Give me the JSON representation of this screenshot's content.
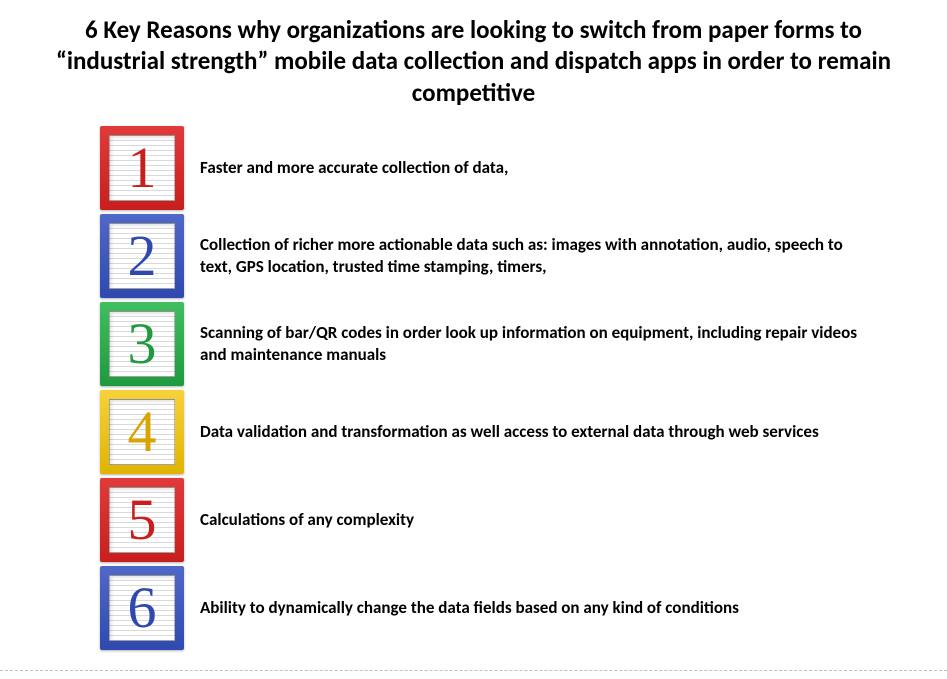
{
  "title": "6 Key Reasons why organizations are looking to switch from paper forms to “industrial strength” mobile data collection and dispatch apps in order to remain competitive",
  "reasons": [
    {
      "num": "1",
      "color": "red",
      "digitColor": "red",
      "text": "Faster and more accurate collection of data,"
    },
    {
      "num": "2",
      "color": "blue",
      "digitColor": "blue",
      "text": "Collection of richer more actionable data such as: images with annotation, audio, speech to text, GPS location, trusted time stamping, timers,"
    },
    {
      "num": "3",
      "color": "green",
      "digitColor": "green",
      "text": "Scanning of bar/QR codes in order look up information on equipment, including repair videos and maintenance manuals"
    },
    {
      "num": "4",
      "color": "yellow",
      "digitColor": "yellow",
      "text": "Data validation and transformation as well access to external data through web services"
    },
    {
      "num": "5",
      "color": "red",
      "digitColor": "red",
      "text": "Calculations of any complexity"
    },
    {
      "num": "6",
      "color": "blue",
      "digitColor": "blue",
      "text": "Ability to dynamically change the data fields based on any kind of conditions"
    }
  ]
}
